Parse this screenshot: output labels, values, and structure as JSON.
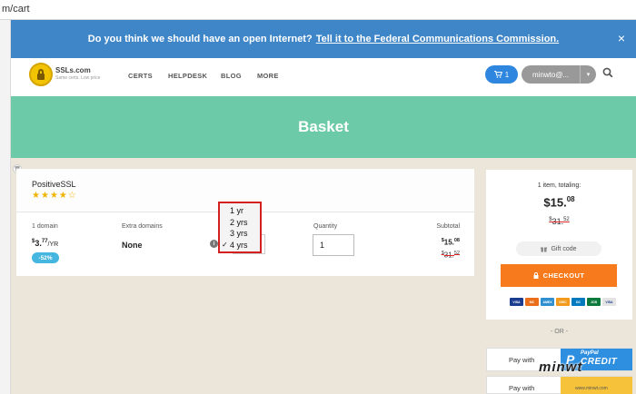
{
  "browser": {
    "url": "m/cart"
  },
  "banner": {
    "text": "Do you think we should have an open Internet?",
    "link": "Tell it to the Federal Communications Commission.",
    "close": "×"
  },
  "nav": {
    "brand": "SSLs.com",
    "tagline": "Same certs. Low price",
    "links": [
      "CERTS",
      "HELPDESK",
      "BLOG",
      "MORE"
    ],
    "cart_count": "1",
    "user": "minwto@..."
  },
  "page": {
    "title": "Basket"
  },
  "product": {
    "name": "PositiveSSL",
    "rating": 4,
    "rating_max": 5,
    "col_domain": "1 domain",
    "col_extra": "Extra domains",
    "col_quantity": "Quantity",
    "col_subtotal": "Subtotal",
    "price_int": "3.",
    "price_dec": "77",
    "price_unit": "/YR",
    "currency": "$",
    "discount": "-52%",
    "extra_value": "None",
    "quantity": "1",
    "subtotal_int": "15.",
    "subtotal_dec": "08",
    "old_subtotal_int": "31.",
    "old_subtotal_dec": "52"
  },
  "period_dropdown": {
    "options": [
      "1 yr",
      "2 yrs",
      "3 yrs",
      "4 yrs"
    ],
    "selected": "4 yrs",
    "highlight_color": "#d42020"
  },
  "summary": {
    "label": "1 item, totaling:",
    "total_int": "15.",
    "total_dec": "08",
    "old_total_int": "31.",
    "old_total_dec": "52",
    "gift_code": "Gift code",
    "checkout": "CHECKOUT",
    "cards": [
      "VISA",
      "MC",
      "AMEX",
      "DISC",
      "DC",
      "JCB",
      "VISA"
    ]
  },
  "alt_payment": {
    "or": "- OR -",
    "pay_with": "Pay with",
    "paypal_brand": "PayPal",
    "paypal_credit": "CREDIT"
  },
  "watermark": {
    "text": "minwt",
    "sub": "www.minwt.com"
  },
  "colors": {
    "banner": "#3f86c8",
    "header": "#6ccaa8",
    "checkout": "#f77a1c",
    "cart_button": "#2e86de",
    "badge": "#45b6e0",
    "paypal": "#2e8fe0",
    "page_bg": "#ebe6d9"
  }
}
